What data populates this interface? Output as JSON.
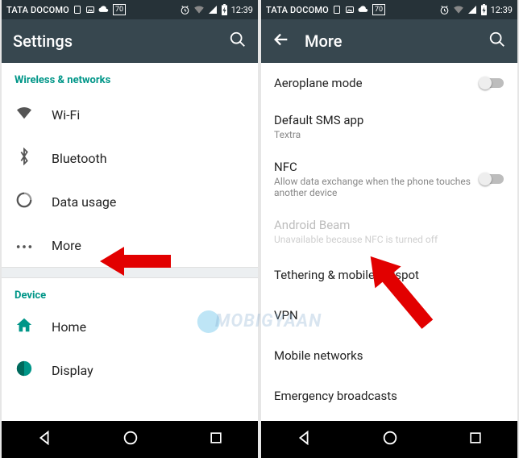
{
  "status": {
    "carrier": "TATA DOCOMO",
    "battery_pct": "70",
    "time": "12:39"
  },
  "left": {
    "title": "Settings",
    "section_wireless": "Wireless & networks",
    "items": {
      "wifi": "Wi-Fi",
      "bluetooth": "Bluetooth",
      "data_usage": "Data usage",
      "more": "More"
    },
    "section_device": "Device",
    "device_items": {
      "home": "Home",
      "display": "Display"
    }
  },
  "right": {
    "title": "More",
    "items": {
      "aeroplane": {
        "label": "Aeroplane mode"
      },
      "default_sms": {
        "label": "Default SMS app",
        "value": "Textra"
      },
      "nfc": {
        "label": "NFC",
        "desc": "Allow data exchange when the phone touches another device"
      },
      "beam": {
        "label": "Android Beam",
        "desc": "Unavailable because NFC is turned off"
      },
      "tether": {
        "label": "Tethering & mobile hotspot"
      },
      "vpn": {
        "label": "VPN"
      },
      "mobile": {
        "label": "Mobile networks"
      },
      "emergency": {
        "label": "Emergency broadcasts"
      }
    }
  },
  "watermark": "MOBIGYAAN"
}
